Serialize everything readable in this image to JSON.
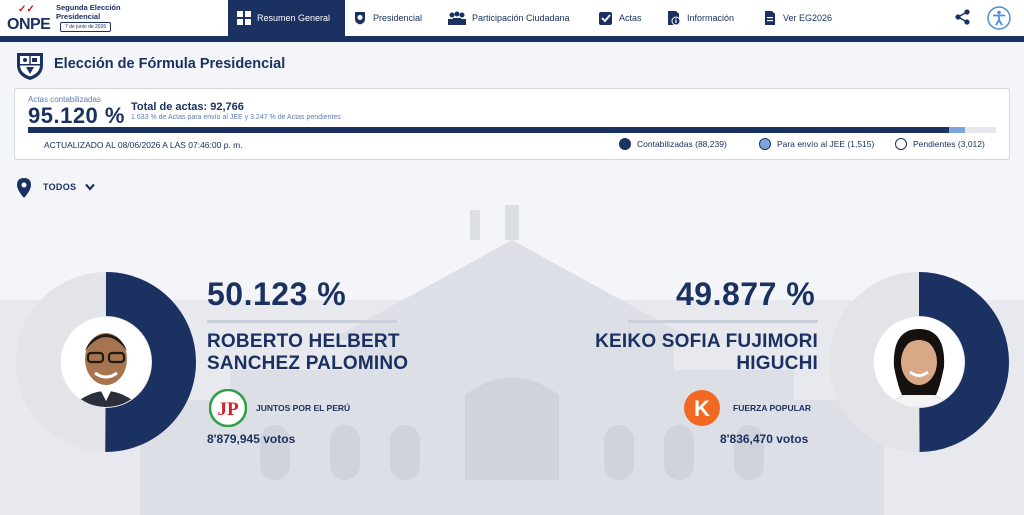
{
  "header": {
    "logo_text": "ONPE",
    "brand_title": "Segunda Elección Presidencial",
    "brand_date": "7 de junio de 2026",
    "nav": [
      {
        "label": "Resumen General",
        "icon": "dashboard-icon",
        "active": true
      },
      {
        "label": "Presidencial",
        "icon": "seal-icon",
        "active": false
      },
      {
        "label": "Participación Ciudadana",
        "icon": "people-icon",
        "active": false
      },
      {
        "label": "Actas",
        "icon": "checkbox-icon",
        "active": false
      },
      {
        "label": "Información",
        "icon": "info-document-icon",
        "active": false
      },
      {
        "label": "Ver EG2026",
        "icon": "document-icon",
        "active": false
      }
    ]
  },
  "page": {
    "title": "Elección de Fórmula Presidencial"
  },
  "summary": {
    "counted_label": "Actas contabilizadas",
    "counted_pct": "95.120 %",
    "total_actas": "Total de actas: 92,766",
    "total_sub": "1.633 % de Actas para envío al JEE y 3.247 % de Actas pendientes",
    "updated": "ACTUALIZADO AL 08/06/2026 A LAS 07:46:00 p. m.",
    "progress": {
      "counted": 0.9512,
      "jee": 0.01633,
      "pending": 0.03247
    },
    "legend": [
      {
        "label": "Contabilizadas (88,239)",
        "color": "#1b3161"
      },
      {
        "label": "Para envío al JEE (1,515)",
        "color": "#7ea5da"
      },
      {
        "label": "Pendientes (3,012)",
        "color": "#ffffff"
      }
    ]
  },
  "filter": {
    "location": "TODOS"
  },
  "candidates": [
    {
      "pct": "50.123 %",
      "share": 0.50123,
      "name_line1": "ROBERTO HELBERT",
      "name_line2": "SANCHEZ PALOMINO",
      "party": "JUNTOS POR EL PERÚ",
      "party_logo_text": "JP",
      "votes": "8'879,945 votos"
    },
    {
      "pct": "49.877 %",
      "share": 0.49877,
      "name_line1": "KEIKO SOFIA FUJIMORI",
      "name_line2": "HIGUCHI",
      "party": "FUERZA POPULAR",
      "party_logo_text": "K",
      "votes": "8'836,470 votos"
    }
  ],
  "colors": {
    "navy": "#1b3161",
    "light_blue": "#7ea5da",
    "donut_bg": "#e3e4e8"
  }
}
